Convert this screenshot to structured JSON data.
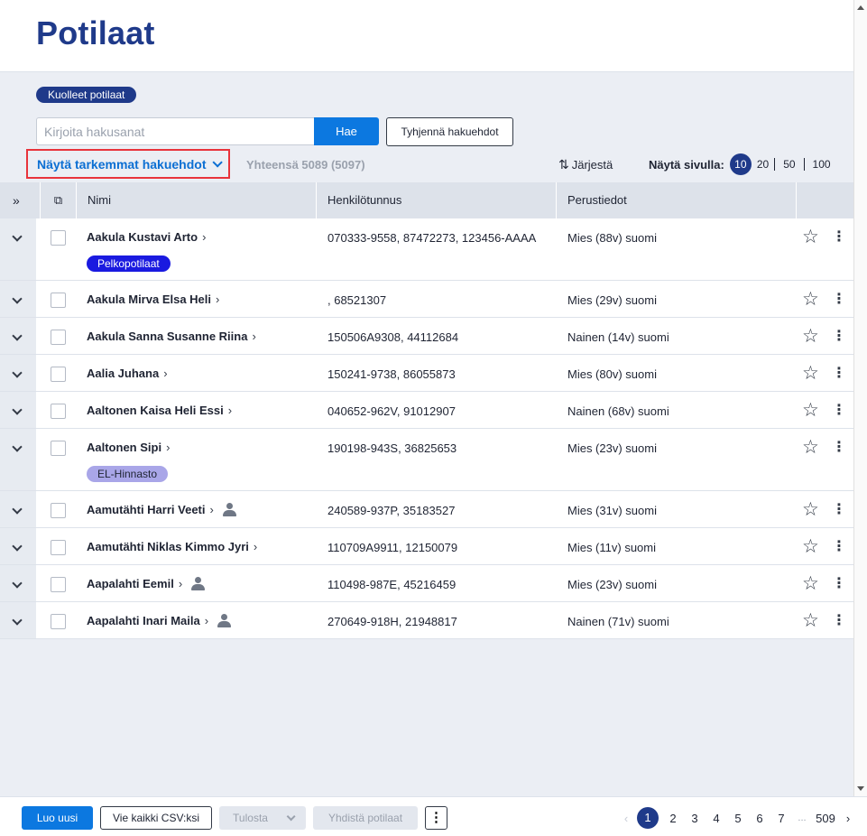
{
  "header": {
    "title": "Potilaat"
  },
  "filters": {
    "deceased_chip": "Kuolleet potilaat",
    "search_placeholder": "Kirjoita hakusanat",
    "search_value": "",
    "search_button": "Hae",
    "clear_button": "Tyhjennä hakuehdot",
    "advanced_toggle": "Näytä tarkemmat hakuehdot",
    "total": "Yhteensä 5089 (5097)",
    "sort_label": "Järjestä",
    "per_page_label": "Näytä sivulla:",
    "per_page_options": [
      "10",
      "20",
      "50",
      "100"
    ],
    "per_page_selected": "10"
  },
  "table": {
    "columns": {
      "name": "Nimi",
      "hetu": "Henkilötunnus",
      "info": "Perustiedot"
    },
    "rows": [
      {
        "name": "Aakula Kustavi Arto",
        "hetu": "070333-9558, 87472273, 123456-AAAA",
        "info": "Mies (88v) suomi",
        "tag": "Pelkopotilaat",
        "tag_color": "#1a1ae0",
        "tag_text_color": "#ffffff",
        "person_icon": false
      },
      {
        "name": "Aakula Mirva Elsa Heli",
        "hetu": ", 68521307",
        "info": "Mies (29v) suomi",
        "tag": "",
        "person_icon": false
      },
      {
        "name": "Aakula Sanna Susanne Riina",
        "hetu": "150506A9308, 44112684",
        "info": "Nainen (14v) suomi",
        "tag": "",
        "person_icon": false
      },
      {
        "name": "Aalia Juhana",
        "hetu": "150241-9738, 86055873",
        "info": "Mies (80v) suomi",
        "tag": "",
        "person_icon": false
      },
      {
        "name": "Aaltonen Kaisa Heli Essi",
        "hetu": "040652-962V, 91012907",
        "info": "Nainen (68v) suomi",
        "tag": "",
        "person_icon": false
      },
      {
        "name": "Aaltonen Sipi",
        "hetu": "190198-943S, 36825653",
        "info": "Mies (23v) suomi",
        "tag": "EL-Hinnasto",
        "tag_color": "#a9a6e8",
        "tag_text_color": "#1f2433",
        "person_icon": false
      },
      {
        "name": "Aamutähti Harri Veeti",
        "hetu": "240589-937P, 35183527",
        "info": "Mies (31v) suomi",
        "tag": "",
        "person_icon": true
      },
      {
        "name": "Aamutähti Niklas Kimmo Jyri",
        "hetu": "110709A9911, 12150079",
        "info": "Mies (11v) suomi",
        "tag": "",
        "person_icon": false
      },
      {
        "name": "Aapalahti Eemil",
        "hetu": "110498-987E, 45216459",
        "info": "Mies (23v) suomi",
        "tag": "",
        "person_icon": true
      },
      {
        "name": "Aapalahti Inari Maila",
        "hetu": "270649-918H, 21948817",
        "info": "Nainen (71v) suomi",
        "tag": "",
        "person_icon": true
      }
    ]
  },
  "footer": {
    "new_button": "Luo uusi",
    "csv_button": "Vie kaikki CSV:ksi",
    "print_button": "Tulosta",
    "merge_button": "Yhdistä potilaat",
    "pages": [
      "1",
      "2",
      "3",
      "4",
      "5",
      "6",
      "7"
    ],
    "current_page": "1",
    "ellipsis": "...",
    "last_page": "509"
  },
  "colors": {
    "brand": "#1f3a8a",
    "primary": "#0c78e0",
    "link": "#0c6fd3",
    "highlight": "#e8333b"
  }
}
